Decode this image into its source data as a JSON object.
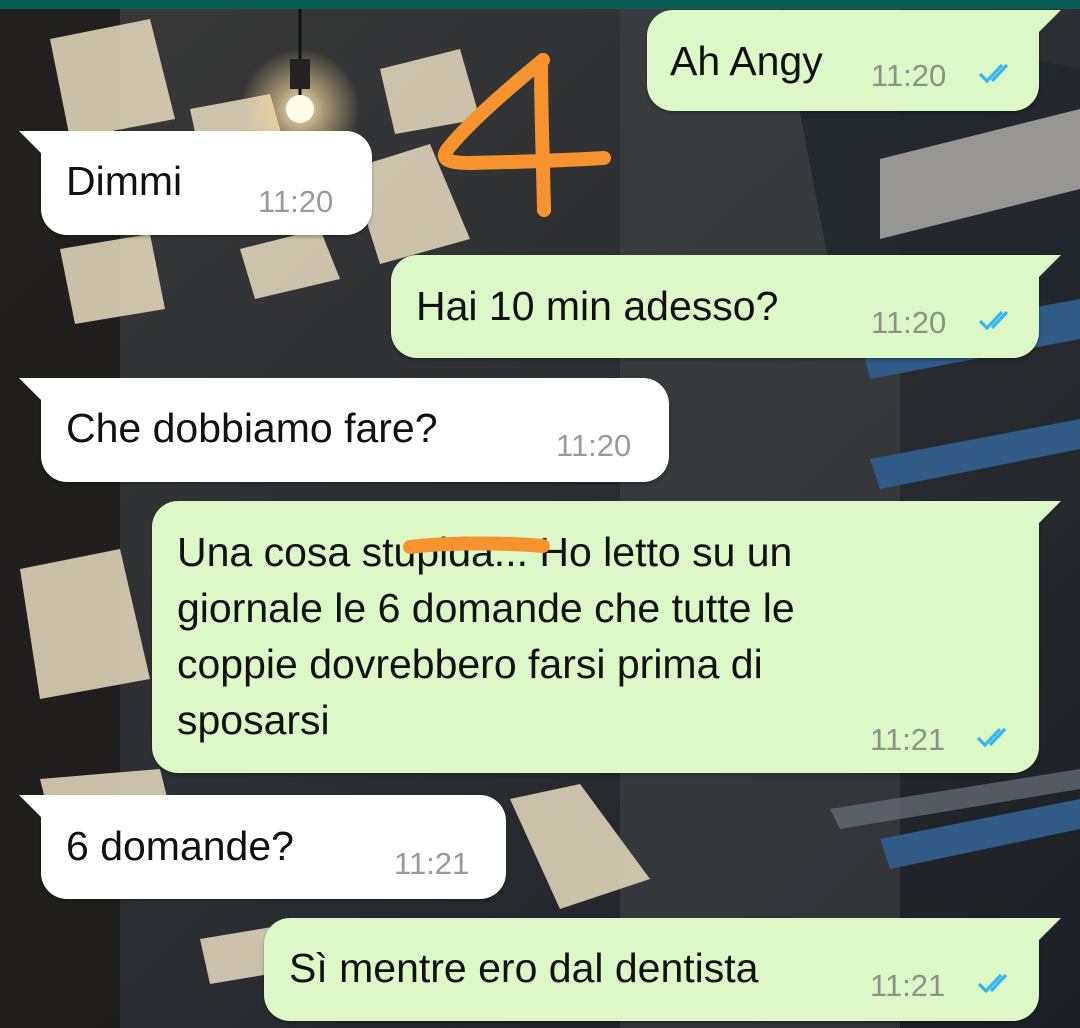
{
  "colors": {
    "outgoing_bubble": "#dcf8c6",
    "incoming_bubble": "#ffffff",
    "read_ticks": "#34b7f1",
    "annotation": "#f7932f",
    "header": "#075e54"
  },
  "messages": [
    {
      "direction": "outgoing",
      "text": "Ah Angy",
      "time": "11:20",
      "status": "read-double-check-icon"
    },
    {
      "direction": "incoming",
      "text": "Dimmi",
      "time": "11:20"
    },
    {
      "direction": "outgoing",
      "text": "Hai 10 min adesso?",
      "time": "11:20",
      "status": "read-double-check-icon"
    },
    {
      "direction": "incoming",
      "text": "Che dobbiamo fare?",
      "time": "11:20"
    },
    {
      "direction": "outgoing",
      "lines": [
        "Una cosa stupida... Ho letto su un",
        "giornale le 6 domande che tutte le",
        "coppie dovrebbero farsi prima di",
        "sposarsi"
      ],
      "time": "11:21",
      "status": "read-double-check-icon"
    },
    {
      "direction": "incoming",
      "text": "6 domande?",
      "time": "11:21"
    },
    {
      "direction": "outgoing",
      "text": "Sì mentre ero dal dentista",
      "time": "11:21",
      "status": "read-double-check-icon"
    }
  ],
  "annotation": {
    "number": "4",
    "strikethrough": "censor-mark"
  }
}
